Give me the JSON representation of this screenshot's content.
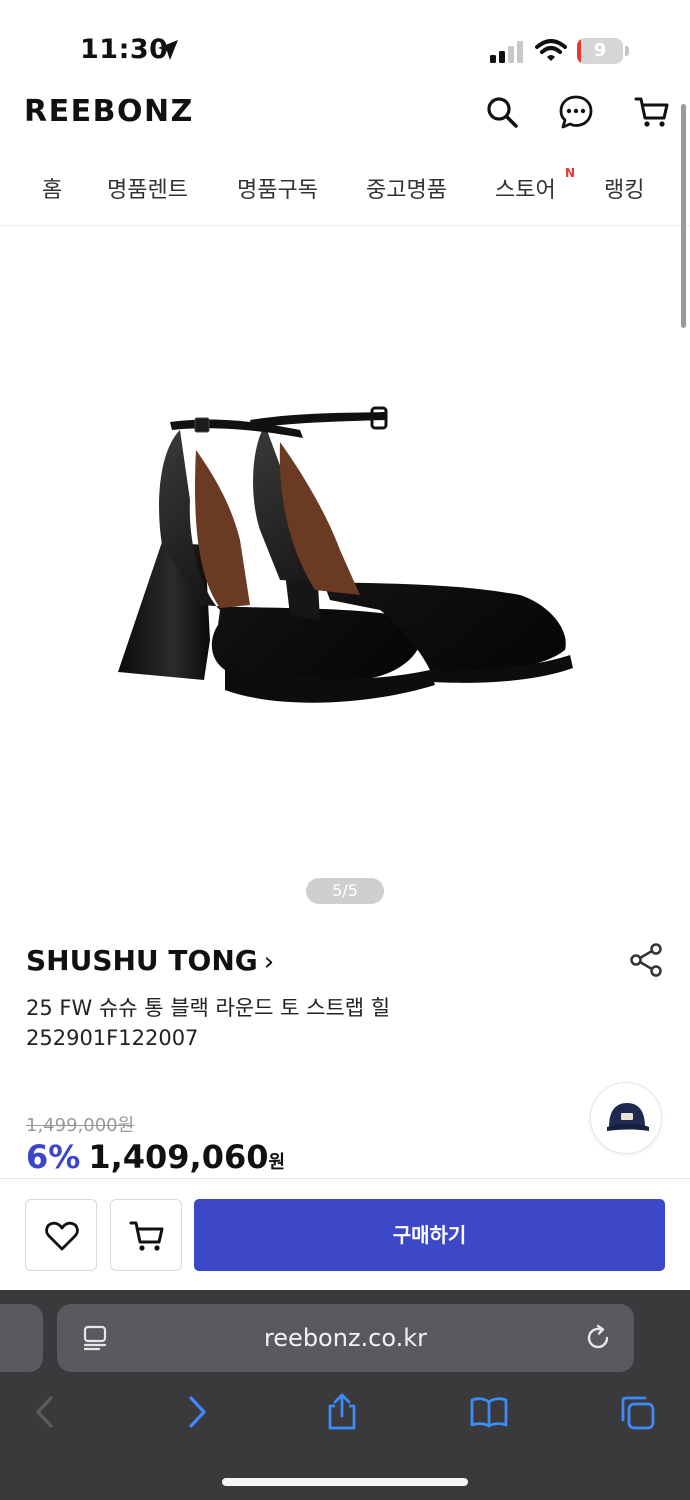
{
  "status_bar": {
    "time": "11:30",
    "battery": "9",
    "battery_level": 0.09
  },
  "header": {
    "logo": "REEBONZ",
    "icons": [
      "search-icon",
      "chat-icon",
      "cart-icon"
    ]
  },
  "nav": {
    "items": [
      {
        "label": "홈"
      },
      {
        "label": "명품렌트"
      },
      {
        "label": "명품구독"
      },
      {
        "label": "중고명품"
      },
      {
        "label": "스토어",
        "badge": "N"
      },
      {
        "label": "랭킹"
      }
    ]
  },
  "gallery": {
    "counter": "5/5"
  },
  "product": {
    "brand": "SHUSHU TONG",
    "brand_chevron": "›",
    "name": "25 FW 슈슈 통 블랙 라운드 토 스트랩 힐",
    "code": "252901F122007",
    "original_price": "1,499,000원",
    "discount": "6%",
    "price": "1,409,060",
    "currency": "원"
  },
  "actions": {
    "buy_label": "구매하기",
    "icons": [
      "heart-icon",
      "cart-icon"
    ]
  },
  "browser": {
    "url": "reebonz.co.kr"
  },
  "colors": {
    "accent": "#3c48c8",
    "discount": "#3b47c7",
    "toolbar_active": "#3d8bf7",
    "badge": "#e53935"
  }
}
